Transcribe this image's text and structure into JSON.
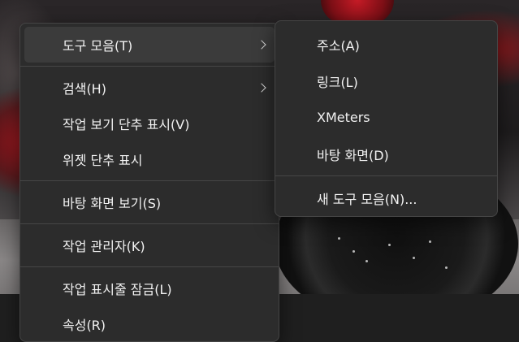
{
  "context_menu": {
    "items": [
      {
        "label": "도구 모음(T)",
        "has_submenu": true,
        "active": true
      },
      {
        "label": "검색(H)",
        "has_submenu": true
      },
      {
        "label": "작업 보기 단추 표시(V)"
      },
      {
        "label": "위젯 단추 표시"
      },
      {
        "label": "바탕 화면 보기(S)"
      },
      {
        "label": "작업 관리자(K)"
      },
      {
        "label": "작업 표시줄 잠금(L)"
      },
      {
        "label": "속성(R)"
      }
    ]
  },
  "toolbars_submenu": {
    "items": [
      {
        "label": "주소(A)"
      },
      {
        "label": "링크(L)"
      },
      {
        "label": "XMeters"
      },
      {
        "label": "바탕 화면(D)"
      },
      {
        "label": "새 도구 모음(N)..."
      }
    ]
  },
  "colors": {
    "menu_background": "#2c2c2c",
    "menu_border": "#454545",
    "hover_background": "#3b3b3b",
    "text": "#f2f2f2",
    "separator": "#464646",
    "taskbar": "#1f1f1f"
  },
  "icons": {
    "submenu_arrow": "chevron-right-icon"
  }
}
